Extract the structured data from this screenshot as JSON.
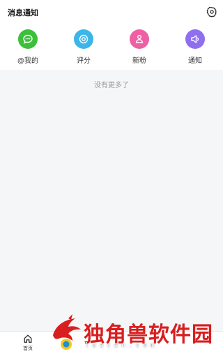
{
  "header": {
    "title": "消息通知"
  },
  "categories": [
    {
      "label": "@我的",
      "icon": "chat-icon",
      "color": "#3cc03a"
    },
    {
      "label": "评分",
      "icon": "target-icon",
      "color": "#3cb6e8"
    },
    {
      "label": "新粉",
      "icon": "fan-icon",
      "color": "#ef5fa3"
    },
    {
      "label": "通知",
      "icon": "speaker-icon",
      "color": "#8f6ef0"
    }
  ],
  "content": {
    "empty_text": "没有更多了"
  },
  "bottom_nav": {
    "home_label": "首页"
  },
  "watermark": {
    "text": "独角兽软件园",
    "url": "luacan.com"
  }
}
